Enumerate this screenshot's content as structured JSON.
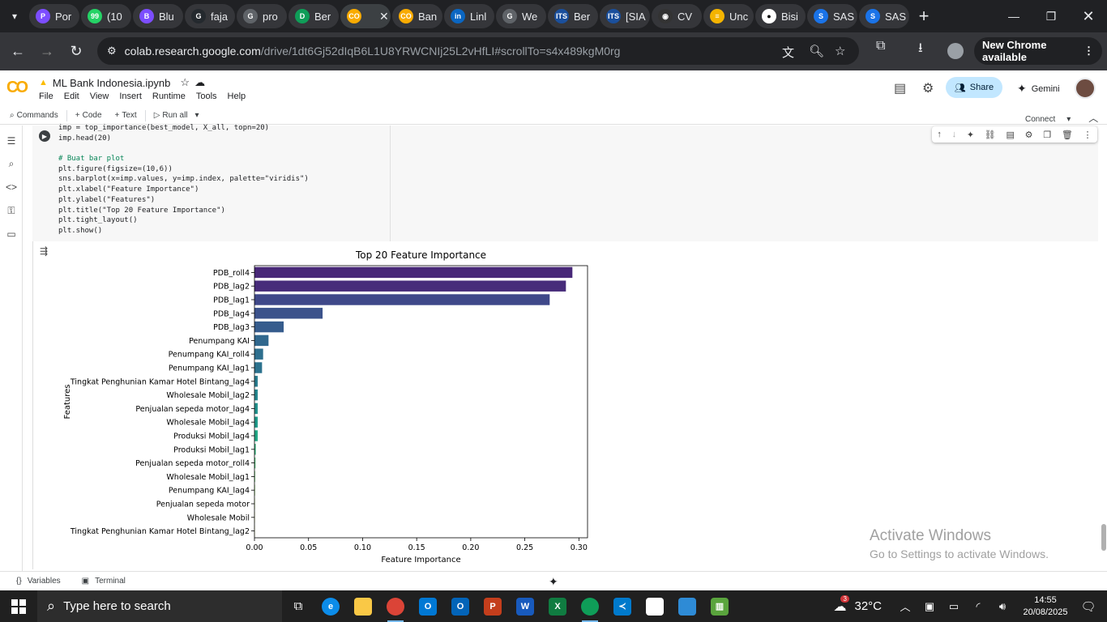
{
  "browser": {
    "tabs": [
      {
        "title": "Por",
        "color": "#7c4dff",
        "glyph": "P"
      },
      {
        "title": "(10",
        "color": "#25d366",
        "glyph": "99"
      },
      {
        "title": "Blu",
        "color": "#7c4dff",
        "glyph": "B"
      },
      {
        "title": "faja",
        "color": "#24292e",
        "glyph": "G"
      },
      {
        "title": "pro",
        "color": "#5f6368",
        "glyph": "G"
      },
      {
        "title": "Ber",
        "color": "#0f9d58",
        "glyph": "D"
      },
      {
        "title": "",
        "color": "#f9ab00",
        "glyph": "CO",
        "active": true
      },
      {
        "title": "Ban",
        "color": "#f9ab00",
        "glyph": "CO"
      },
      {
        "title": "Linl",
        "color": "#0a66c2",
        "glyph": "in"
      },
      {
        "title": "We",
        "color": "#5f6368",
        "glyph": "G"
      },
      {
        "title": "Ber",
        "color": "#1a4f9c",
        "glyph": "ITS"
      },
      {
        "title": "[SIA",
        "color": "#1a4f9c",
        "glyph": "ITS"
      },
      {
        "title": "CV",
        "color": "#333333",
        "glyph": "◉"
      },
      {
        "title": "Unc",
        "color": "#f4b400",
        "glyph": "≡"
      },
      {
        "title": "Bisi",
        "color": "#ffffff",
        "glyph": "●"
      },
      {
        "title": "SAS",
        "color": "#1a73e8",
        "glyph": "S"
      },
      {
        "title": "SAS",
        "color": "#1a73e8",
        "glyph": "S"
      }
    ],
    "url_host": "colab.research.google.com",
    "url_path": "/drive/1dt6Gj52dIqB6L1U8YRWCNIj25L2vHfLI#scrollTo=s4x489kgM0rg",
    "new_chrome_label": "New Chrome available"
  },
  "colab": {
    "notebook_title": "ML Bank Indonesia.ipynb",
    "menu": [
      "File",
      "Edit",
      "View",
      "Insert",
      "Runtime",
      "Tools",
      "Help"
    ],
    "share_label": "Share",
    "gemini_label": "Gemini",
    "toolbar": {
      "commands": "Commands",
      "code": "Code",
      "text": "Text",
      "run_all": "Run all",
      "connect": "Connect"
    },
    "code_lines": [
      "imp = top_importance(best_model, X_all, topn=20)",
      "imp.head(20)",
      "",
      "# Buat bar plot",
      "plt.figure(figsize=(10,6))",
      "sns.barplot(x=imp.values, y=imp.index, palette=\"viridis\")",
      "plt.xlabel(\"Feature Importance\")",
      "plt.ylabel(\"Features\")",
      "plt.title(\"Top 20 Feature Importance\")",
      "plt.tight_layout()",
      "plt.show()"
    ],
    "statusbar": {
      "variables": "Variables",
      "terminal": "Terminal"
    }
  },
  "chart_data": {
    "type": "bar",
    "orientation": "horizontal",
    "title": "Top 20 Feature Importance",
    "xlabel": "Feature Importance",
    "ylabel": "Features",
    "xlim": [
      0,
      0.308
    ],
    "xticks": [
      "0.00",
      "0.05",
      "0.10",
      "0.15",
      "0.20",
      "0.25",
      "0.30"
    ],
    "categories": [
      "PDB_roll4",
      "PDB_lag2",
      "PDB_lag1",
      "PDB_lag4",
      "PDB_lag3",
      "Penumpang KAI",
      "Penumpang KAI_roll4",
      "Penumpang KAI_lag1",
      "Tingkat Penghunian Kamar Hotel Bintang_lag4",
      "Wholesale Mobil_lag2",
      "Penjualan sepeda motor_lag4",
      "Wholesale Mobil_lag4",
      "Produksi Mobil_lag4",
      "Produksi Mobil_lag1",
      "Penjualan sepeda motor_roll4",
      "Wholesale Mobil_lag1",
      "Penumpang KAI_lag4",
      "Penjualan sepeda motor",
      "Wholesale Mobil",
      "Tingkat Penghunian Kamar Hotel Bintang_lag2"
    ],
    "values": [
      0.294,
      0.288,
      0.273,
      0.063,
      0.027,
      0.013,
      0.008,
      0.007,
      0.003,
      0.003,
      0.003,
      0.003,
      0.003,
      0.0012,
      0.0009,
      0.0006,
      0.0005,
      0.0004,
      0.0003,
      0.0002
    ],
    "colors": [
      "#482878",
      "#472c7a",
      "#3f4889",
      "#3b528b",
      "#365c8d",
      "#31688e",
      "#2e6f8e",
      "#2c728e",
      "#287c8e",
      "#24868e",
      "#21918c",
      "#1f9a8a",
      "#22a785",
      "#2fb47c",
      "#44bf70",
      "#5ec962",
      "#7ad151",
      "#9bd93c",
      "#bddf26",
      "#dfe318"
    ],
    "grid": false,
    "legend": "none"
  },
  "windows": {
    "activate_title": "Activate Windows",
    "activate_sub": "Go to Settings to activate Windows."
  },
  "taskbar": {
    "search_placeholder": "Type here to search",
    "weather": "32°C",
    "weather_badge": "3",
    "time": "14:55",
    "date": "20/08/2025"
  }
}
